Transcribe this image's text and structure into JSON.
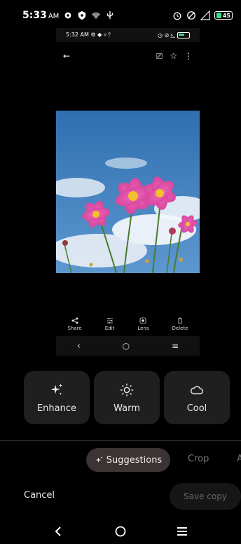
{
  "status_bar": {
    "time": "5:33",
    "ampm": "AM",
    "battery": "45"
  },
  "inner_screenshot": {
    "time": "5:32",
    "ampm": "AM",
    "actions": [
      {
        "label": "Share",
        "icon": "share-icon"
      },
      {
        "label": "Edit",
        "icon": "tune-icon"
      },
      {
        "label": "Lens",
        "icon": "lens-icon"
      },
      {
        "label": "Delete",
        "icon": "trash-icon"
      }
    ]
  },
  "suggestions": [
    {
      "label": "Enhance",
      "icon": "sparkle-icon"
    },
    {
      "label": "Warm",
      "icon": "sun-icon"
    },
    {
      "label": "Cool",
      "icon": "cloud-icon"
    }
  ],
  "tabs": {
    "suggestions": "Suggestions",
    "crop": "Crop",
    "more": "A"
  },
  "footer": {
    "cancel": "Cancel",
    "save_copy": "Save copy"
  },
  "colors": {
    "background": "#000000",
    "card": "#1f1f1f",
    "active_tab": "#3a3434",
    "battery_fill": "#3ddc84"
  }
}
